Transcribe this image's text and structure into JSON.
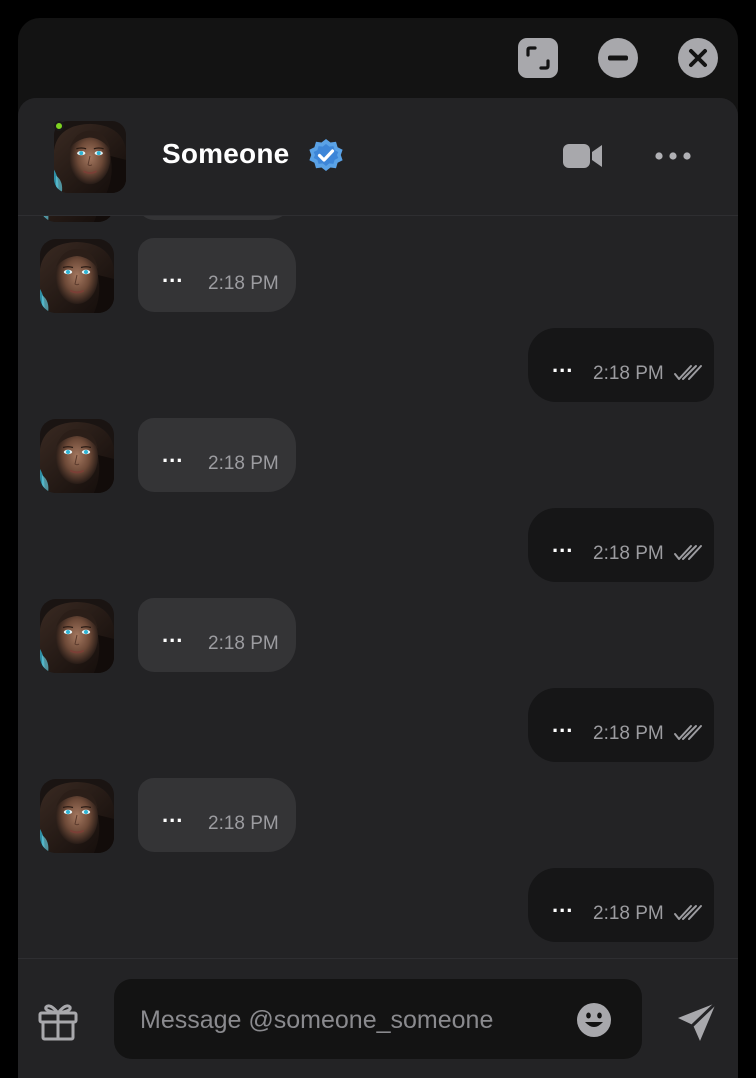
{
  "window": {
    "controls": [
      "expand-icon",
      "minimize-icon",
      "close-icon"
    ]
  },
  "header": {
    "name": "Someone",
    "online": true,
    "verified": true,
    "icons": [
      "video-camera-icon",
      "more-horizontal-icon"
    ]
  },
  "messages": [
    {
      "dir": "in",
      "text": "...",
      "time": "2:18 PM"
    },
    {
      "dir": "out",
      "text": "...",
      "time": "2:18 PM",
      "read": true
    },
    {
      "dir": "in",
      "text": "...",
      "time": "2:18 PM"
    },
    {
      "dir": "out",
      "text": "...",
      "time": "2:18 PM",
      "read": true
    },
    {
      "dir": "in",
      "text": "...",
      "time": "2:18 PM"
    },
    {
      "dir": "out",
      "text": "...",
      "time": "2:18 PM",
      "read": true
    },
    {
      "dir": "in",
      "text": "...",
      "time": "2:18 PM"
    },
    {
      "dir": "out",
      "text": "...",
      "time": "2:18 PM",
      "read": true
    }
  ],
  "composer": {
    "placeholder": "Message @someone_someone",
    "value": "",
    "icons": [
      "gift-icon",
      "emoji-icon",
      "send-icon"
    ]
  },
  "colors": {
    "background": "#131313",
    "chat_panel": "#232325",
    "incoming_bubble": "#343436",
    "outgoing_bubble": "#161617",
    "online": "#7ed321",
    "verified": "#4a90e2"
  }
}
